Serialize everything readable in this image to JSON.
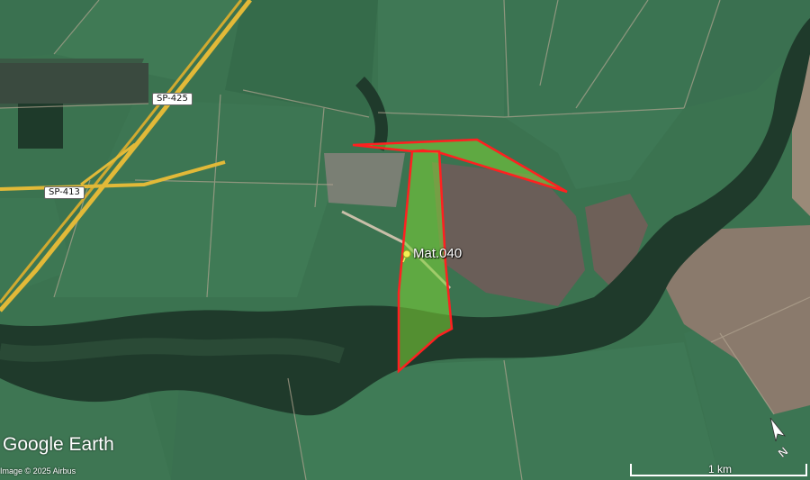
{
  "map": {
    "road_labels": [
      "SP-425",
      "SP-413"
    ],
    "placemark": {
      "name": "Mat.040",
      "icon": "pushpin-icon"
    },
    "field_polygon": {
      "stroke_color": "#ff2020",
      "fill_color": "#7dd636"
    }
  },
  "branding": {
    "logo_text": "Google Earth",
    "credit": "Image © 2025 Airbus"
  },
  "scale_bar": {
    "label": "1 km"
  },
  "compass": {
    "label": "N",
    "icon": "north-arrow-icon"
  },
  "colors": {
    "field_green": "#3f7a4f",
    "forest_dark": "#1f3a2a",
    "bare_soil": "#6e6259",
    "highway": "#e2b938"
  }
}
